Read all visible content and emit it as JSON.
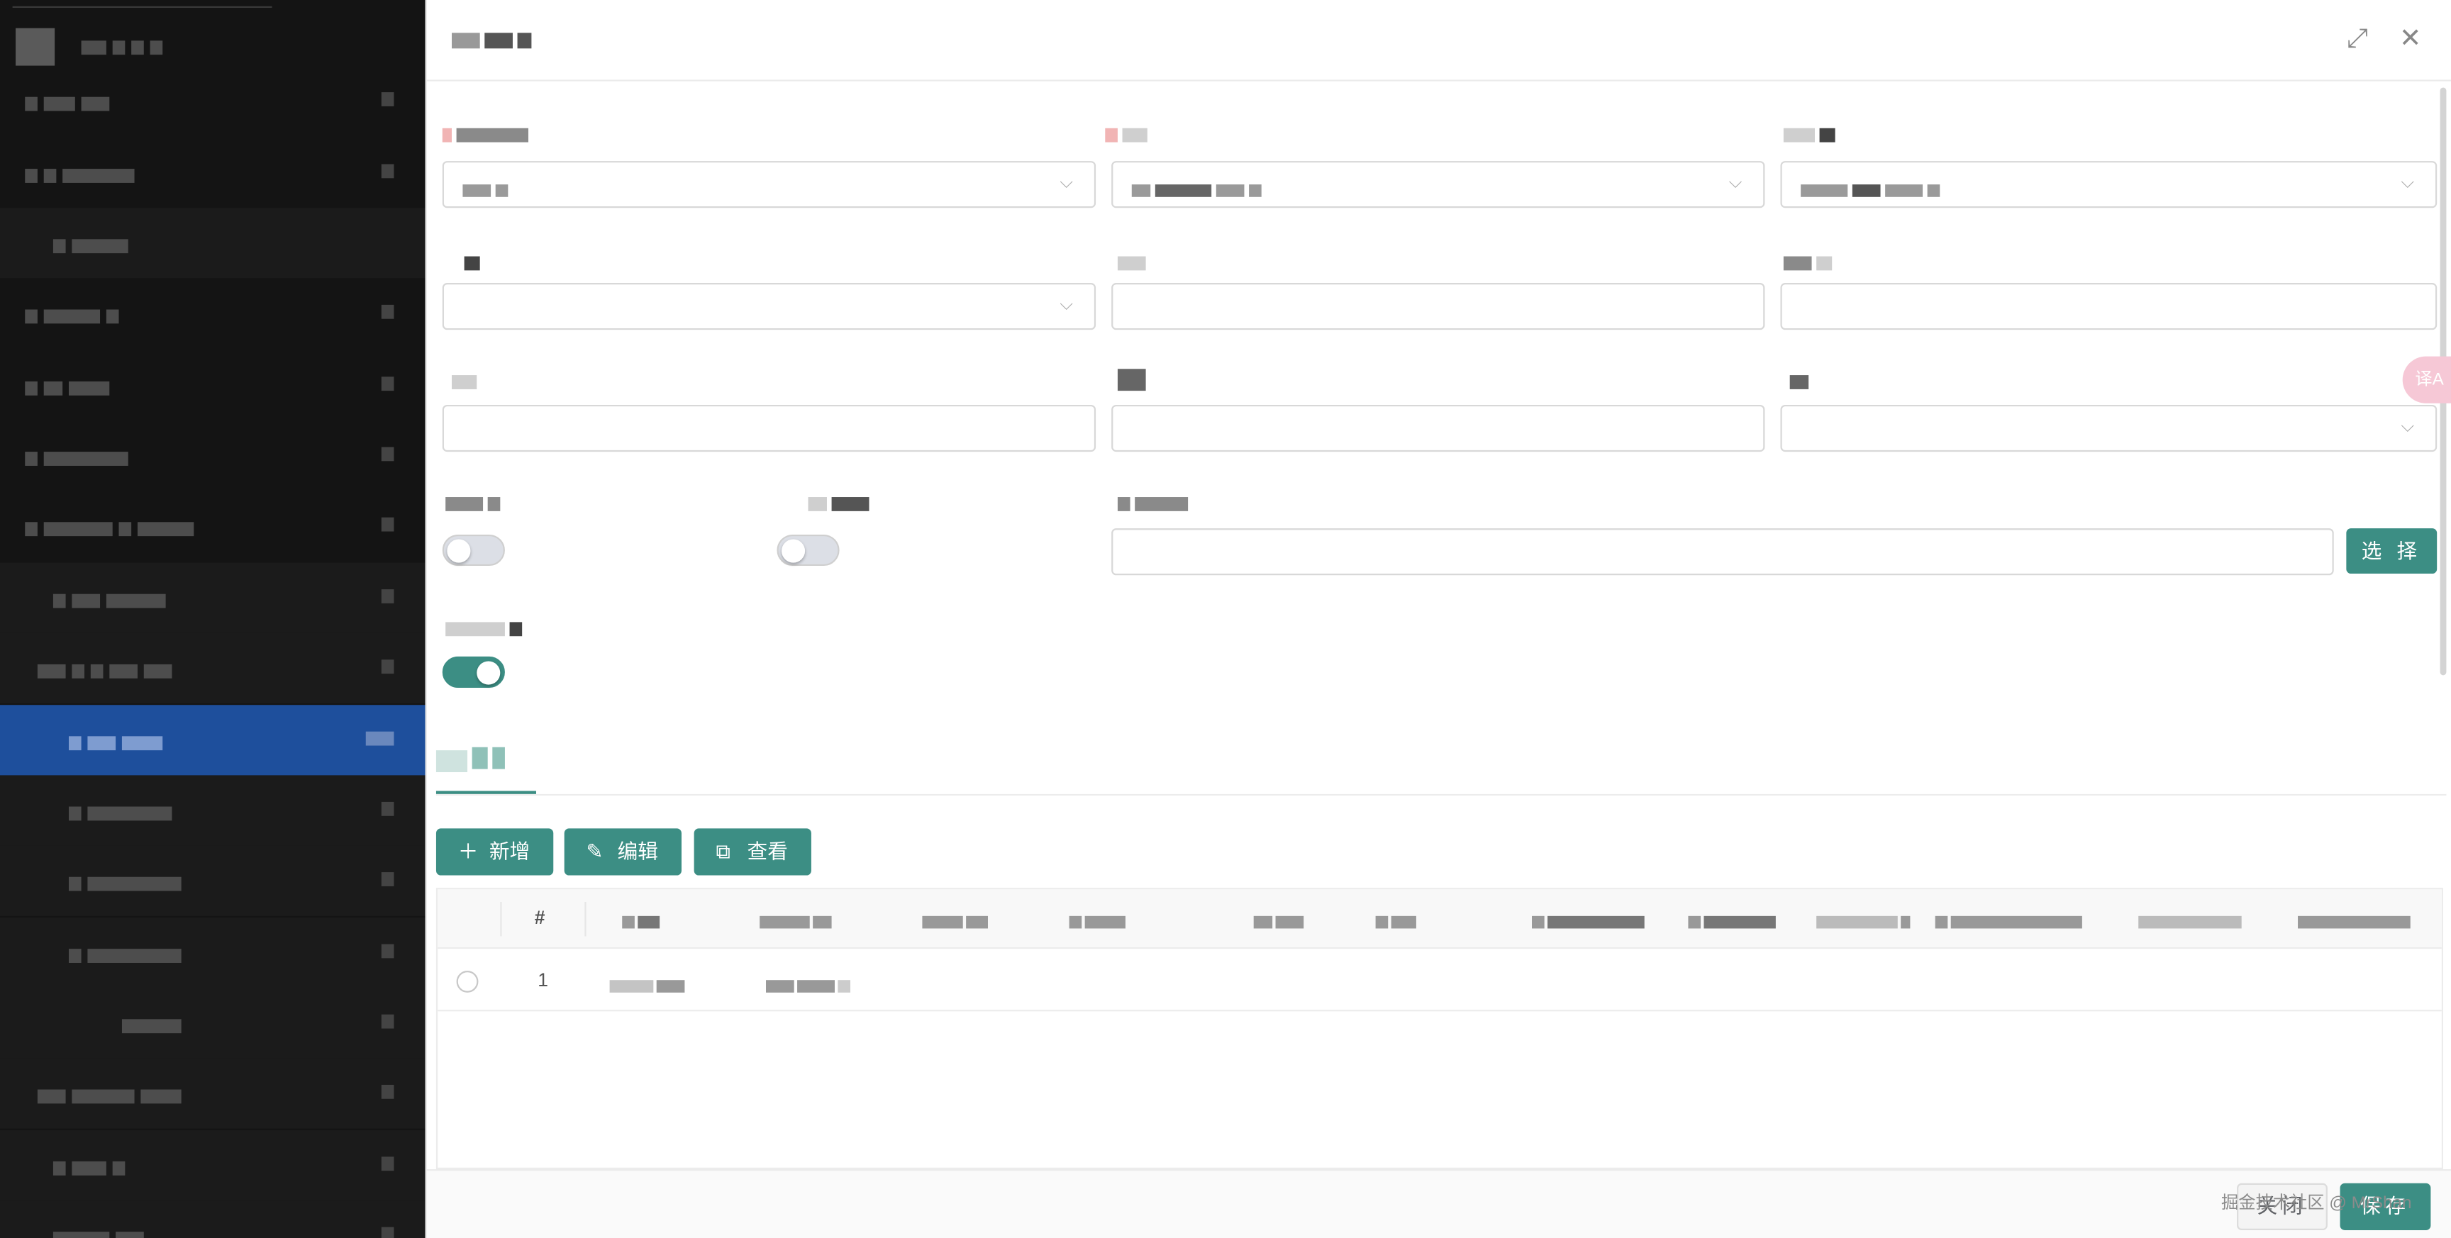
{
  "dialog": {
    "fullscreen_icon": "⤢",
    "close_icon": "✕",
    "select_button": "选 择",
    "tab_active": "",
    "toolbar": {
      "add_label": "新增",
      "edit_label": "编辑",
      "view_label": "查看"
    },
    "table": {
      "index_header": "#",
      "rows": [
        {
          "index": "1"
        }
      ]
    },
    "footer": {
      "close_label": "关闭",
      "save_label": "保存",
      "watermark": "掘金技术社区 @ MrShan"
    },
    "switches": {
      "switch1_on": false,
      "switch2_on": false,
      "switch3_on": true
    },
    "translate_badge": "译A"
  },
  "colors": {
    "primary": "#3c8e84",
    "sidebar_bg": "#141414",
    "sidebar_active": "#1e4f9c"
  }
}
